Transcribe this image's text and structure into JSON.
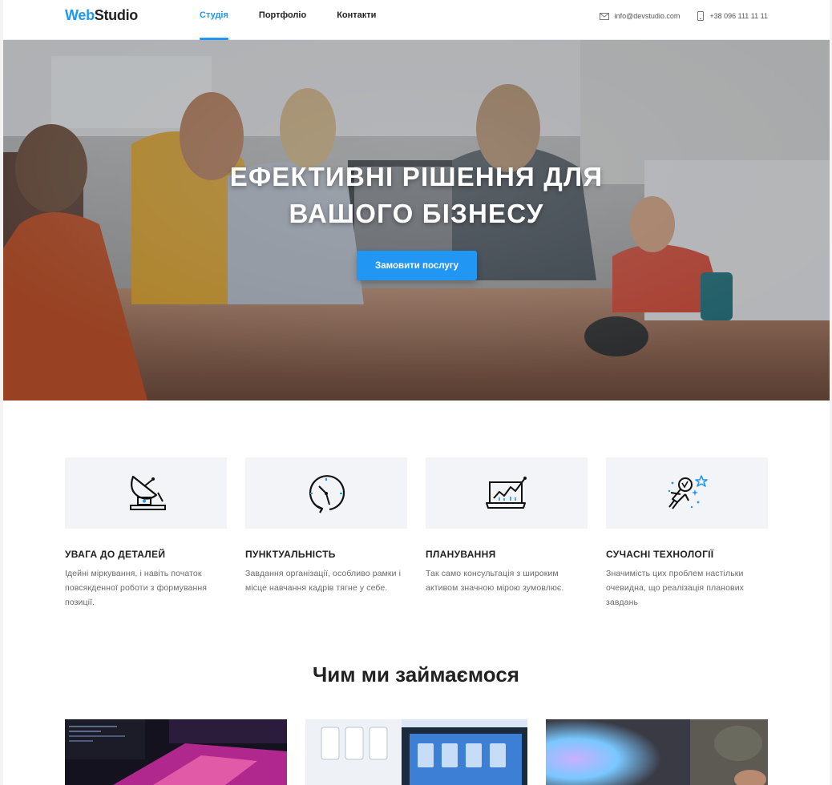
{
  "header": {
    "logo_accent": "Web",
    "logo_rest": "Studio",
    "nav": [
      {
        "label": "Студія",
        "active": true
      },
      {
        "label": "Портфоліо",
        "active": false
      },
      {
        "label": "Контакти",
        "active": false
      }
    ],
    "email": "info@devstudio.com",
    "phone": "+38 096 111 11 11"
  },
  "hero": {
    "title_line1": "Ефективні рішення для",
    "title_line2": "вашого бізнесу",
    "button_label": "Замовити послугу"
  },
  "features": [
    {
      "icon": "satellite-dish-icon",
      "title": "Увага до деталей",
      "text": "Ідейні міркування, і навіть початок повсякденної роботи з формування позиції."
    },
    {
      "icon": "clock-icon",
      "title": "Пунктуальність",
      "text": "Завдання організації, особливо рамки і місце навчання кадрів тягне у себе."
    },
    {
      "icon": "chart-laptop-icon",
      "title": "Планування",
      "text": "Так само консультація з широким активом значною мірою зумовлює."
    },
    {
      "icon": "astronaut-icon",
      "title": "Сучасні технології",
      "text": "Значимість цих проблем настільки очевидна, що реалізація планових завдань"
    }
  ],
  "section": {
    "title": "Чим ми займаємося"
  },
  "colors": {
    "accent": "#2196f3",
    "text": "#212121",
    "muted": "#6a6a6a",
    "feature_bg": "#f3f4f8"
  }
}
